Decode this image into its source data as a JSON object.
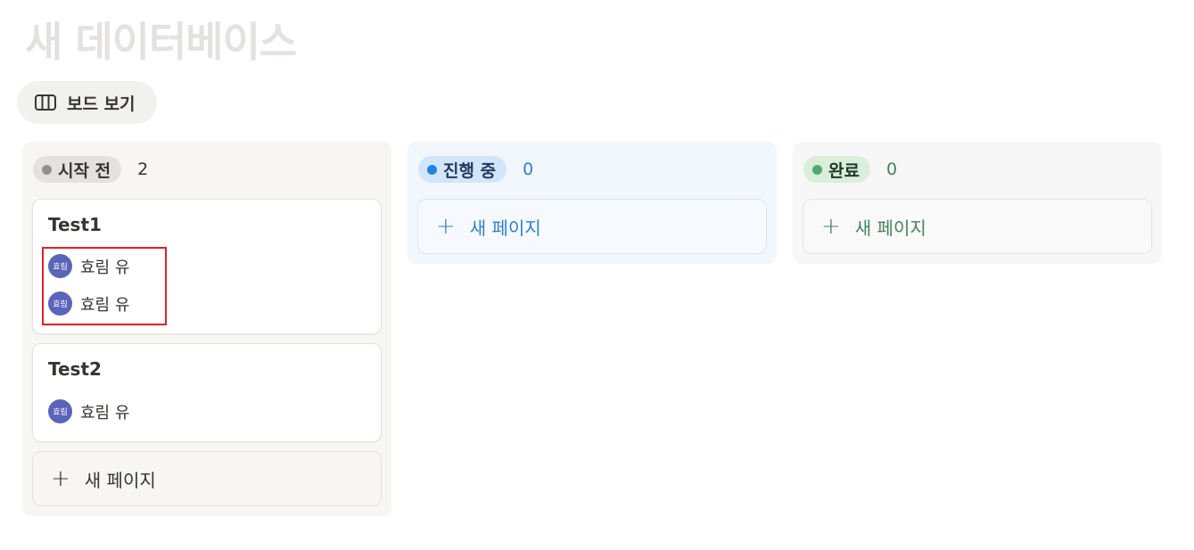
{
  "page": {
    "title": "새 데이터베이스",
    "view_tab_label": "보드 보기"
  },
  "colors": {
    "avatar": "#5a64b8",
    "highlight": "#e0202b",
    "status_gray": "#91918e",
    "status_blue": "#2383e2",
    "status_green": "#4dab6d"
  },
  "columns": [
    {
      "label": "시작 전",
      "count": "2",
      "cards": [
        {
          "title": "Test1",
          "people": [
            {
              "avatar": "효림",
              "name": "효림 유"
            },
            {
              "avatar": "효림",
              "name": "효림 유"
            }
          ]
        },
        {
          "title": "Test2",
          "people": [
            {
              "avatar": "효림",
              "name": "효림 유"
            }
          ]
        }
      ],
      "new_page_label": "새 페이지"
    },
    {
      "label": "진행 중",
      "count": "0",
      "cards": [],
      "new_page_label": "새 페이지"
    },
    {
      "label": "완료",
      "count": "0",
      "cards": [],
      "new_page_label": "새 페이지"
    }
  ]
}
